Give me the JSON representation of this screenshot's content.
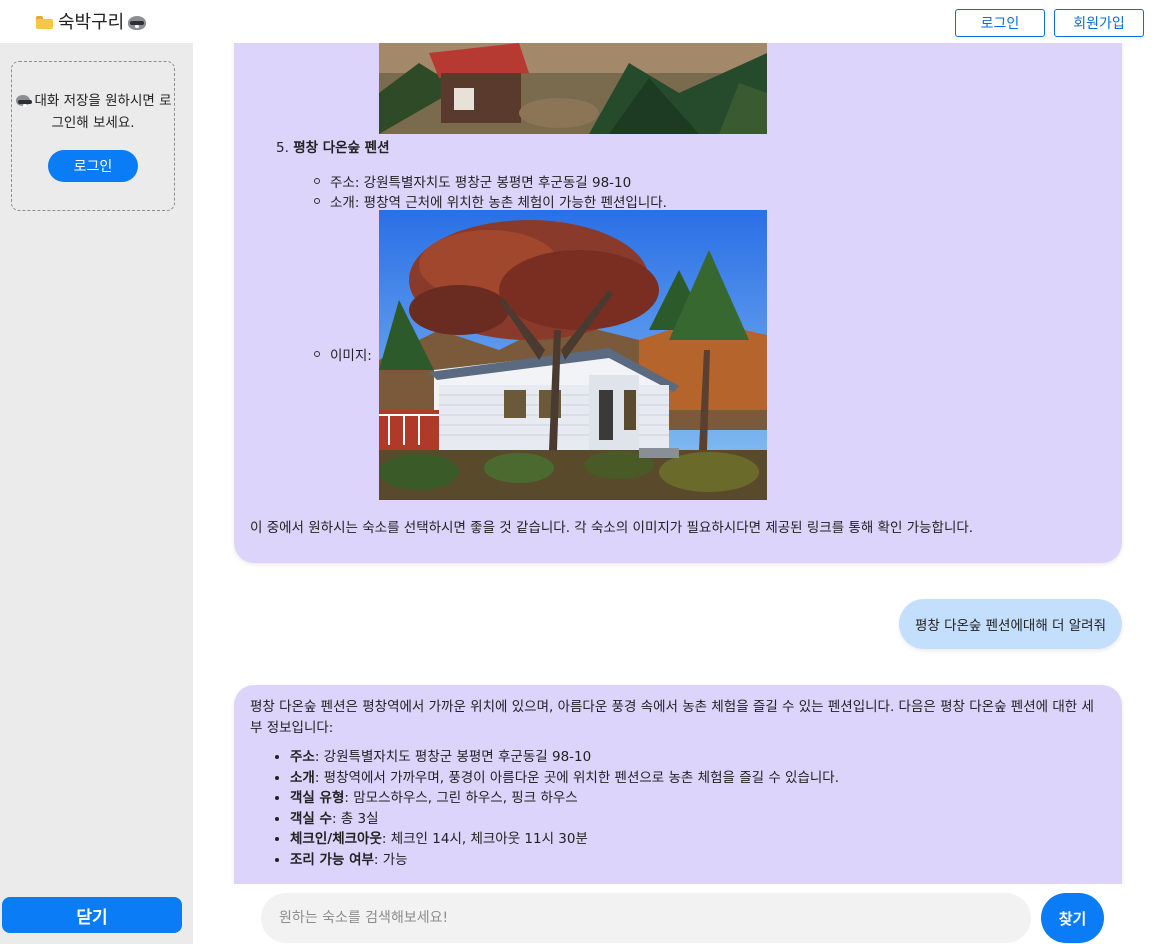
{
  "header": {
    "app_title": "숙박구리",
    "login_label": "로그인",
    "signup_label": "회원가입",
    "icons": [
      "folder-icon",
      "raccoon-icon"
    ]
  },
  "sidebar": {
    "login_message": "대화 저장을 원하시면 로그인해 보세요.",
    "login_button": "로그인",
    "close_button": "닫기"
  },
  "chat": {
    "bot_message_1": {
      "item_number": "5.",
      "item_title": "평창 다온숲 펜션",
      "address": "주소: 강원특별자치도 평창군 봉평면 후군동길 98-10",
      "intro": "소개: 평창역 근처에 위치한 농촌 체험이 가능한 펜션입니다.",
      "image_label": "이미지:",
      "closing": "이 중에서 원하시는 숙소를 선택하시면 좋을 것 같습니다. 각 숙소의 이미지가 필요하시다면 제공된 링크를 통해 확인 가능합니다."
    },
    "user_message": "평창 다온숲 펜션에대해 더 알려줘",
    "bot_message_2": {
      "intro": "평창 다온숲 펜션은 평창역에서 가까운 위치에 있으며, 아름다운 풍경 속에서 농촌 체험을 즐길 수 있는 펜션입니다. 다음은 평창 다온숲 펜션에 대한 세부 정보입니다:",
      "details": [
        {
          "label": "주소",
          "value": ": 강원특별자치도 평창군 봉평면 후군동길 98-10"
        },
        {
          "label": "소개",
          "value": ": 평창역에서 가까우며, 풍경이 아름다운 곳에 위치한 펜션으로 농촌 체험을 즐길 수 있습니다."
        },
        {
          "label": "객실 유형",
          "value": ": 맘모스하우스, 그린 하우스, 핑크 하우스"
        },
        {
          "label": "객실 수",
          "value": ": 총 3실"
        },
        {
          "label": "체크인/체크아웃",
          "value": ": 체크인 14시, 체크아웃 11시 30분"
        },
        {
          "label": "조리 가능 여부",
          "value": ": 가능"
        }
      ]
    }
  },
  "input": {
    "placeholder": "원하는 숙소를 검색해보세요!",
    "submit_label": "찾기"
  },
  "colors": {
    "accent": "#0a7cf5",
    "bot_bubble": "#dcd4fa",
    "user_bubble": "#c4dffc",
    "sidebar_bg": "#ebebeb"
  }
}
